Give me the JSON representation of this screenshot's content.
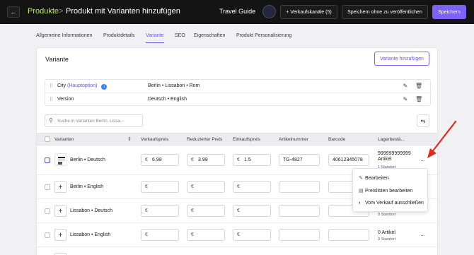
{
  "topbar": {
    "back_icon": "arrow-left-icon",
    "breadcrumb_root": "Produkte",
    "breadcrumb_sep": ">",
    "breadcrumb_current": "Produkt mit Varianten hinzufügen",
    "shop_name": "Travel Guide",
    "channels_label": "+ Verkaufskanäle (5)",
    "save_draft_label": "Speichern ohne zu veröffentlichen",
    "save_label": "Speichern"
  },
  "tabs": [
    {
      "label": "Allgemeine Informationen"
    },
    {
      "label": "Produktdetails"
    },
    {
      "label": "Variante"
    },
    {
      "label": "SEO"
    },
    {
      "label": "Eigenschaften"
    },
    {
      "label": "Produkt Personalisierung"
    }
  ],
  "variant_panel": {
    "title": "Variante",
    "add_label": "Variante hinzufügen",
    "options": [
      {
        "name": "City",
        "sub": "(Hauptoption)",
        "values": "Berlin • Lissabon • Rom"
      },
      {
        "name": "Version",
        "sub": "",
        "values": "Deutsch • English"
      }
    ],
    "search_placeholder": "Suche in Varianten Berlin, Lissa..."
  },
  "table": {
    "headers": [
      "Varianten",
      "Verkaufspreis",
      "Reduzierter Preis",
      "Einkaufspreis",
      "Artikelnummer",
      "Barcode",
      "Lagerbestä..."
    ],
    "currency": "€",
    "rows": [
      {
        "name": "Berlin • Deutsch",
        "price": "6.99",
        "reduced": "3.99",
        "purchase": "1.5",
        "sku": "TG-4827",
        "barcode": "40612345078",
        "stock": "999999999999 Artikel",
        "location": "1 Standort"
      },
      {
        "name": "Berlin • English",
        "price": "",
        "reduced": "",
        "purchase": "",
        "sku": "",
        "barcode": "",
        "stock": "",
        "location": ""
      },
      {
        "name": "Lissabon • Deutsch",
        "price": "",
        "reduced": "",
        "purchase": "",
        "sku": "",
        "barcode": "",
        "stock": "",
        "location": "0 Standort"
      },
      {
        "name": "Lissabon • English",
        "price": "",
        "reduced": "",
        "purchase": "",
        "sku": "",
        "barcode": "",
        "stock": "0 Artikel",
        "location": "0 Standort"
      }
    ]
  },
  "context_menu": {
    "items": [
      {
        "label": "Bearbeiten",
        "icon": "pencil-icon"
      },
      {
        "label": "Preislisten bearbeiten",
        "icon": "price-list-icon"
      },
      {
        "label": "Vom Verkauf ausschließen",
        "icon": "eye-off-icon"
      }
    ]
  },
  "colors": {
    "accent": "#7c63f5",
    "brand_green": "#b9f53d",
    "annotation_arrow": "#e8281e"
  }
}
